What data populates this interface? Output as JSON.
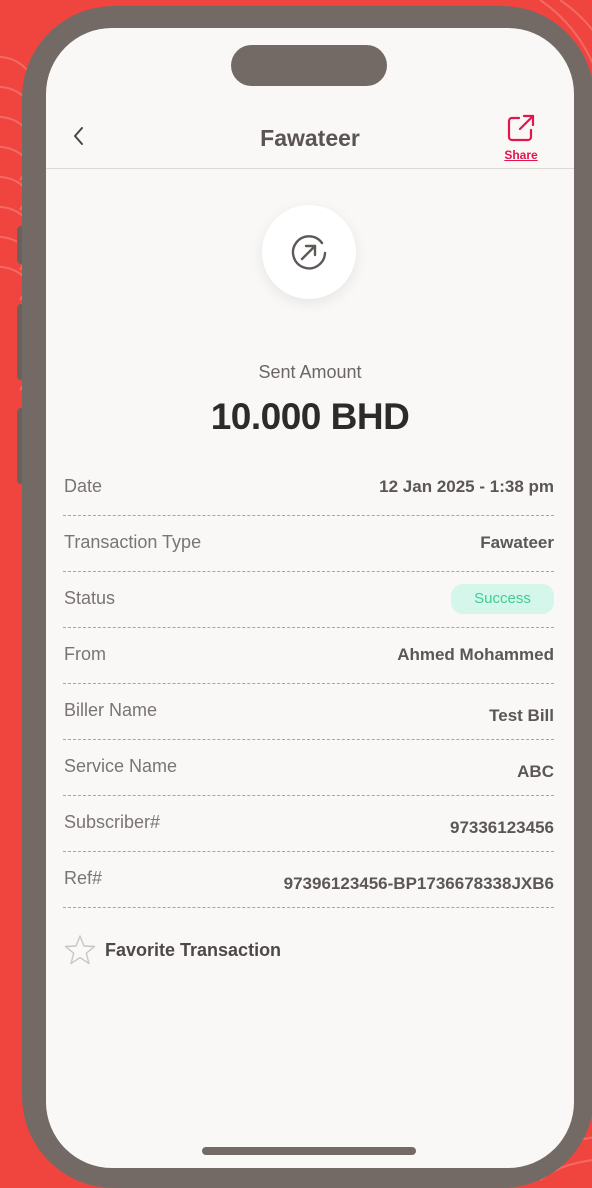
{
  "header": {
    "title": "Fawateer",
    "share_label": "Share"
  },
  "summary": {
    "sent_label": "Sent Amount",
    "amount": "10.000 BHD"
  },
  "details": [
    {
      "label": "Date",
      "value": "12 Jan 2025 - 1:38 pm"
    },
    {
      "label": "Transaction Type",
      "value": "Fawateer"
    },
    {
      "label": "Status",
      "value": "Success"
    },
    {
      "label": "From",
      "value": "Ahmed Mohammed"
    },
    {
      "label": "Biller Name",
      "value": "Test Bill"
    },
    {
      "label": "Service Name",
      "value": "ABC"
    },
    {
      "label": "Subscriber#",
      "value": "97336123456"
    },
    {
      "label": "Ref#",
      "value": "97396123456-BP1736678338JXB6"
    }
  ],
  "favorite": {
    "label": "Favorite Transaction"
  },
  "icons": {
    "back": "chevron-left-icon",
    "share": "share-external-icon",
    "sent": "arrow-up-right-circle-icon",
    "favorite": "star-outline-icon"
  },
  "colors": {
    "background": "#f0453f",
    "phone_frame": "#736a66",
    "screen": "#f9f8f6",
    "accent": "#e1164e",
    "success_bg": "#d5f6ea",
    "success_text": "#3dcf93"
  }
}
